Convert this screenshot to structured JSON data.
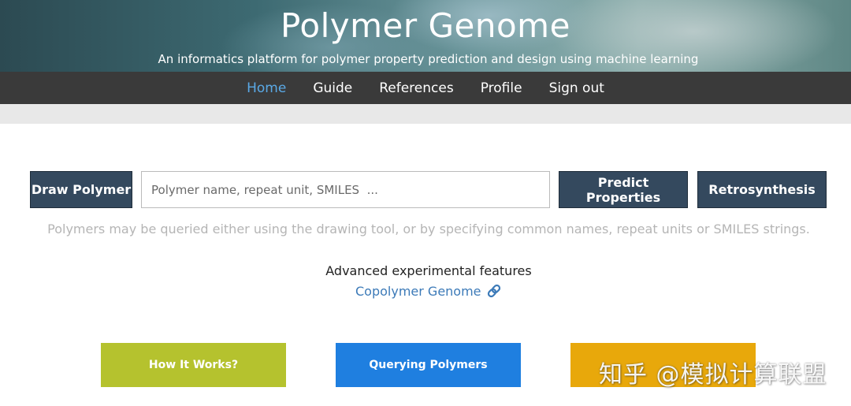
{
  "header": {
    "title": "Polymer Genome",
    "subtitle": "An informatics platform for polymer property prediction and design using machine learning"
  },
  "nav": {
    "items": [
      {
        "label": "Home",
        "active": true
      },
      {
        "label": "Guide"
      },
      {
        "label": "References"
      },
      {
        "label": "Profile"
      },
      {
        "label": "Sign out"
      }
    ]
  },
  "search": {
    "draw_label": "Draw Polymer",
    "placeholder": "Polymer name, repeat unit, SMILES  ...",
    "value": "",
    "predict_label": "Predict Properties",
    "retro_label": "Retrosynthesis",
    "hint": "Polymers may be queried either using the drawing tool, or by specifying common names, repeat units or SMILES strings."
  },
  "advanced": {
    "title": "Advanced experimental features",
    "link_label": "Copolymer Genome",
    "link_icon": "link-icon"
  },
  "tiles": [
    {
      "label": "How It Works?",
      "color": "#b5c22e"
    },
    {
      "label": "Querying Polymers",
      "color": "#1f7fe0"
    },
    {
      "label": "",
      "color": "#e8a80b"
    }
  ],
  "watermark": "知乎 @模拟计算联盟",
  "colors": {
    "navbar": "#3a3a3a",
    "nav_active": "#5aa9e6",
    "dark_button": "#34495e",
    "link": "#3c7ab8"
  }
}
